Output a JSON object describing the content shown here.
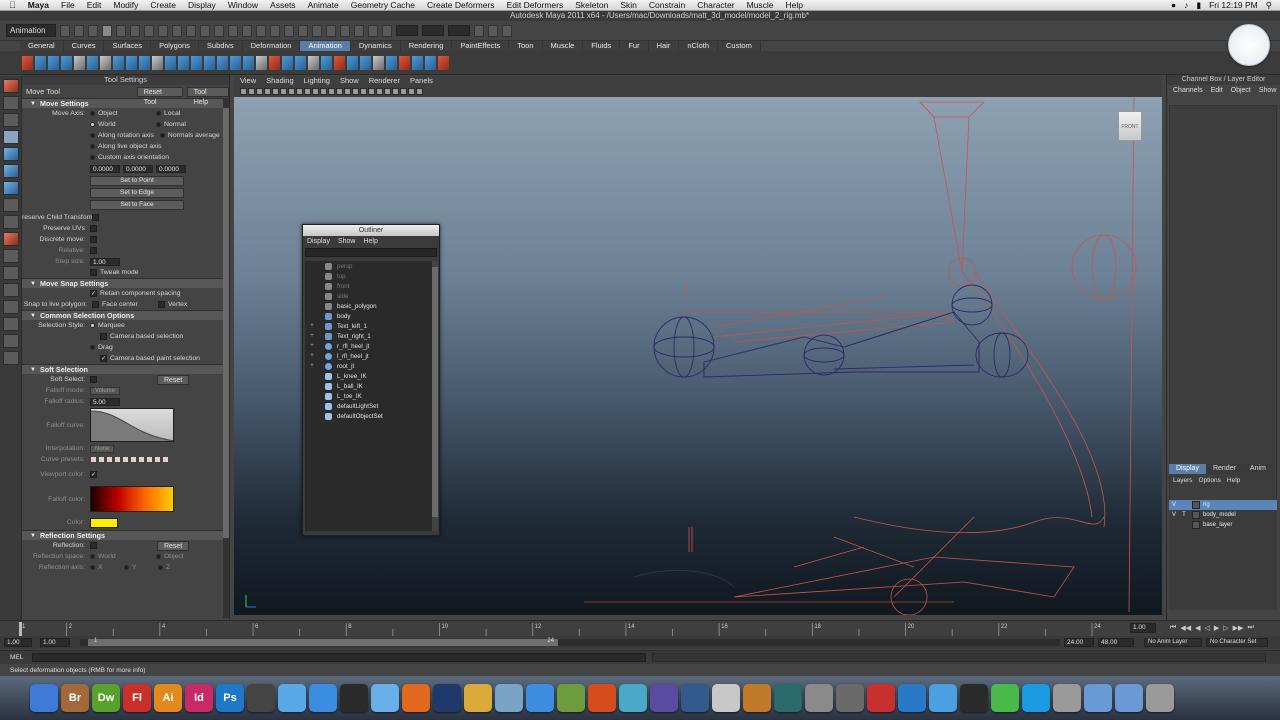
{
  "mac_menubar": {
    "items": [
      "Maya",
      "File",
      "Edit",
      "Modify",
      "Create",
      "Display",
      "Window",
      "Assets",
      "Animate",
      "Geometry Cache",
      "Create Deformers",
      "Edit Deformers",
      "Skeleton",
      "Skin",
      "Constrain",
      "Character",
      "Muscle",
      "Help"
    ],
    "clock": "Fri 12:19 PM"
  },
  "window_title": "Autodesk Maya 2011 x64 - /Users/mac/Downloads/matt_3d_model/model_2_rig.mb*",
  "status_line": {
    "mode": "Animation"
  },
  "shelf": {
    "tabs": [
      "General",
      "Curves",
      "Surfaces",
      "Polygons",
      "Subdivs",
      "Deformation",
      "Animation",
      "Dynamics",
      "Rendering",
      "PaintEffects",
      "Toon",
      "Muscle",
      "Fluids",
      "Fur",
      "Hair",
      "nCloth",
      "Custom"
    ],
    "active": "Animation"
  },
  "tool_settings": {
    "header": "Tool Settings",
    "tool_name": "Move Tool",
    "reset_label": "Reset Tool",
    "help_label": "Tool Help",
    "move_settings": {
      "title": "Move Settings",
      "axis_label": "Move Axis:",
      "object": "Object",
      "local": "Local",
      "world": "World",
      "normal": "Normal",
      "along_rotation": "Along rotation axis",
      "normals_average": "Normals average",
      "along_live": "Along live object axis",
      "custom_axis": "Custom axis orientation",
      "v1": "0.0000",
      "v2": "0.0000",
      "v3": "0.0000",
      "set_point": "Set to Point",
      "set_edge": "Set to Edge",
      "set_face": "Set to Face",
      "preserve_child": "reserve Child Transform",
      "preserve_uvs": "Preserve UVs",
      "discrete": "Discrete move:",
      "relative": "Relative:",
      "step_label": "Step size:",
      "step_value": "1.00",
      "tweak": "Tweak mode"
    },
    "snap": {
      "title": "Move Snap Settings",
      "retain": "Retain component spacing",
      "live_label": "Snap to live polygon:",
      "face_center": "Face center",
      "vertex": "Vertex"
    },
    "common": {
      "title": "Common Selection Options",
      "style_label": "Selection Style:",
      "marquee": "Marquee",
      "camera_sel": "Camera based selection",
      "drag": "Drag",
      "camera_paint": "Camera based paint selection"
    },
    "soft": {
      "title": "Soft Selection",
      "soft_label": "Soft Select:",
      "reset": "Reset",
      "falloff_mode_label": "Falloff mode:",
      "falloff_mode": "Volume",
      "falloff_radius_label": "Falloff radius:",
      "falloff_radius": "5.00",
      "falloff_curve_label": "Falloff curve:",
      "interp_label": "Interpolation:",
      "interp": "None",
      "presets_label": "Curve presets:",
      "viewport_color_label": "Viewport color:",
      "falloff_color_label": "Falloff color:",
      "color_label": "Color:"
    },
    "reflection": {
      "title": "Reflection Settings",
      "reflection_label": "Reflection:",
      "reset": "Reset",
      "space_label": "Reflection space:",
      "world": "World",
      "object": "Object",
      "axis_label": "Reflection axis:",
      "x": "X",
      "y": "Y",
      "z": "Z"
    }
  },
  "viewport": {
    "menu": [
      "View",
      "Shading",
      "Lighting",
      "Show",
      "Renderer",
      "Panels"
    ],
    "cube_label": "FRONT"
  },
  "outliner": {
    "title": "Outliner",
    "menu": [
      "Display",
      "Show",
      "Help"
    ],
    "items": [
      {
        "name": "persp",
        "dim": true,
        "plus": false,
        "icon": "cam"
      },
      {
        "name": "top",
        "dim": true,
        "plus": false,
        "icon": "cam"
      },
      {
        "name": "front",
        "dim": true,
        "plus": false,
        "icon": "cam"
      },
      {
        "name": "side",
        "dim": true,
        "plus": false,
        "icon": "cam"
      },
      {
        "name": "basic_polygon",
        "dim": false,
        "plus": false,
        "icon": "cam"
      },
      {
        "name": "body",
        "dim": false,
        "plus": false,
        "icon": "mesh"
      },
      {
        "name": "Text_left_1",
        "dim": false,
        "plus": true,
        "icon": "mesh"
      },
      {
        "name": "Text_right_1",
        "dim": false,
        "plus": true,
        "icon": "mesh"
      },
      {
        "name": "r_rfl_heel_jt",
        "dim": false,
        "plus": true,
        "icon": "jnt"
      },
      {
        "name": "l_rfl_heel_jt",
        "dim": false,
        "plus": true,
        "icon": "jnt"
      },
      {
        "name": "root_jt",
        "dim": false,
        "plus": true,
        "icon": "jnt"
      },
      {
        "name": "L_knee_IK",
        "dim": false,
        "plus": false,
        "icon": "set"
      },
      {
        "name": "L_ball_IK",
        "dim": false,
        "plus": false,
        "icon": "set"
      },
      {
        "name": "L_toe_IK",
        "dim": false,
        "plus": false,
        "icon": "set"
      },
      {
        "name": "defaultLightSet",
        "dim": false,
        "plus": false,
        "icon": "set"
      },
      {
        "name": "defaultObjectSet",
        "dim": false,
        "plus": false,
        "icon": "set"
      }
    ]
  },
  "channel_box": {
    "header": "Channel Box / Layer Editor",
    "menu": [
      "Channels",
      "Edit",
      "Object",
      "Show"
    ],
    "layer_tabs": [
      "Display",
      "Render",
      "Anim"
    ],
    "layer_menu": [
      "Layers",
      "Options",
      "Help"
    ],
    "layers": [
      {
        "v": "V",
        "p": "",
        "name": "rig",
        "selected": true
      },
      {
        "v": "V",
        "p": "T",
        "name": "body_model",
        "selected": false
      },
      {
        "v": "",
        "p": "",
        "name": "base_layer",
        "selected": false
      }
    ]
  },
  "time_slider": {
    "ticks": [
      "1",
      "2",
      "4",
      "6",
      "8",
      "10",
      "12",
      "14",
      "16",
      "18",
      "20",
      "22",
      "24"
    ],
    "current_frame": "1.00"
  },
  "range_slider": {
    "start": "1.00",
    "start2": "1.00",
    "range_start": "1",
    "range_end": "24",
    "end": "24.00",
    "end2": "48.00",
    "anim_layer": "No Anim Layer",
    "character_set": "No Character Set"
  },
  "command_line": {
    "label": "MEL"
  },
  "help_line": {
    "text": "Select deformation objects (RMB for more info)"
  },
  "dock": {
    "icons": [
      {
        "name": "finder-icon",
        "label": "",
        "color": "#3d7bd6"
      },
      {
        "name": "bridge-icon",
        "label": "Br",
        "color": "#a3693a"
      },
      {
        "name": "dreamweaver-icon",
        "label": "Dw",
        "color": "#5aa02c"
      },
      {
        "name": "flash-icon",
        "label": "Fl",
        "color": "#c8302a"
      },
      {
        "name": "illustrator-icon",
        "label": "Ai",
        "color": "#e08a1e"
      },
      {
        "name": "indesign-icon",
        "label": "Id",
        "color": "#c72a66"
      },
      {
        "name": "photoshop-icon",
        "label": "Ps",
        "color": "#1d78c7"
      },
      {
        "name": "clapper-icon",
        "label": "",
        "color": "#444444"
      },
      {
        "name": "dropbox-icon",
        "label": "",
        "color": "#5aa7e6"
      },
      {
        "name": "appstore-icon",
        "label": "",
        "color": "#3a8de0"
      },
      {
        "name": "camera-icon",
        "label": "",
        "color": "#2a2a2a"
      },
      {
        "name": "safari-icon",
        "label": "",
        "color": "#6ab0e8"
      },
      {
        "name": "firefox-icon",
        "label": "",
        "color": "#e0691e"
      },
      {
        "name": "globe-icon",
        "label": "",
        "color": "#1f3a6a"
      },
      {
        "name": "notes-icon",
        "label": "",
        "color": "#d9a93a"
      },
      {
        "name": "preview-icon",
        "label": "",
        "color": "#7aa4c6"
      },
      {
        "name": "itunes-icon",
        "label": "",
        "color": "#3e8ee0"
      },
      {
        "name": "iphoto-icon",
        "label": "",
        "color": "#6d9c3e"
      },
      {
        "name": "recorder-icon",
        "label": "",
        "color": "#d54d1d"
      },
      {
        "name": "gems-icon",
        "label": "",
        "color": "#4aa8c8"
      },
      {
        "name": "film-icon",
        "label": "",
        "color": "#5a4aa0"
      },
      {
        "name": "pen-icon",
        "label": "",
        "color": "#335a8c"
      },
      {
        "name": "sketch-icon",
        "label": "",
        "color": "#c8c8c8"
      },
      {
        "name": "guitar-icon",
        "label": "",
        "color": "#c07a2a"
      },
      {
        "name": "timemachine-icon",
        "label": "",
        "color": "#2a6a6a"
      },
      {
        "name": "prefs-icon",
        "label": "",
        "color": "#8a8a8a"
      },
      {
        "name": "keychain-icon",
        "label": "",
        "color": "#6a6a6a"
      },
      {
        "name": "calendar-icon",
        "label": "",
        "color": "#c83030"
      },
      {
        "name": "world-icon",
        "label": "",
        "color": "#2a78c8"
      },
      {
        "name": "wheel-icon",
        "label": "",
        "color": "#4aa0e0"
      },
      {
        "name": "qq-icon",
        "label": "",
        "color": "#2a2a2a"
      },
      {
        "name": "messenger-icon",
        "label": "",
        "color": "#4ab84a"
      },
      {
        "name": "skype-icon",
        "label": "",
        "color": "#1a9ae0"
      },
      {
        "name": "tool-icon",
        "label": "",
        "color": "#9a9a9a"
      },
      {
        "name": "folder-icon",
        "label": "",
        "color": "#6a9ad6"
      },
      {
        "name": "folder2-icon",
        "label": "",
        "color": "#6a9ad6"
      },
      {
        "name": "trash-icon",
        "label": "",
        "color": "#9a9a9a"
      }
    ]
  }
}
